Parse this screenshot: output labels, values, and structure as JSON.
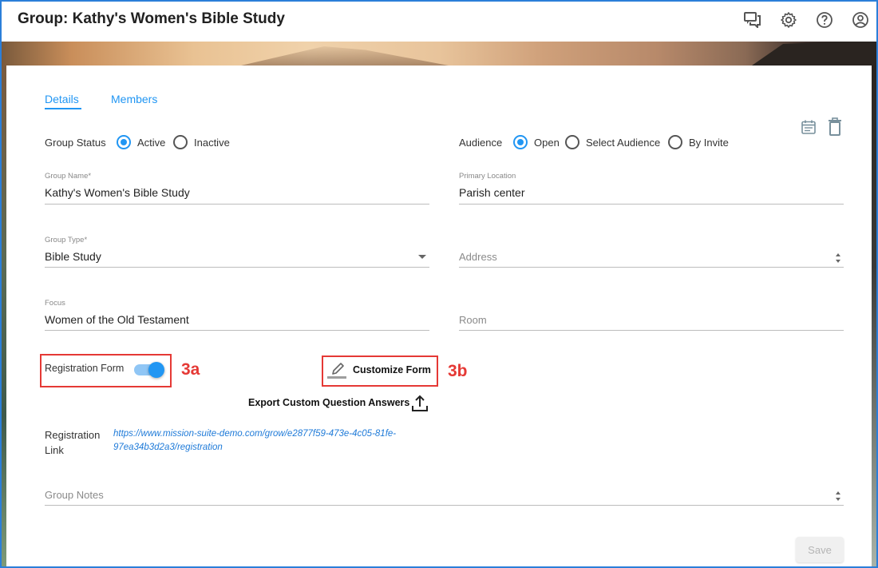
{
  "header": {
    "title": "Group: Kathy's Women's Bible Study",
    "icons": [
      "chat-icon",
      "gear-icon",
      "help-icon",
      "account-icon"
    ]
  },
  "tabs": [
    {
      "label": "Details",
      "active": true
    },
    {
      "label": "Members",
      "active": false
    }
  ],
  "group_status": {
    "label": "Group Status",
    "options": [
      "Active",
      "Inactive"
    ],
    "selected": "Active"
  },
  "audience": {
    "label": "Audience",
    "options": [
      "Open",
      "Select Audience",
      "By Invite"
    ],
    "selected": "Open"
  },
  "fields": {
    "group_name": {
      "label": "Group Name*",
      "value": "Kathy's Women's Bible Study"
    },
    "primary_location": {
      "label": "Primary Location",
      "value": "Parish center"
    },
    "group_type": {
      "label": "Group Type*",
      "value": "Bible Study"
    },
    "address": {
      "placeholder": "Address"
    },
    "focus": {
      "label": "Focus",
      "value": "Women of the Old Testament"
    },
    "room": {
      "placeholder": "Room"
    },
    "group_notes": {
      "placeholder": "Group Notes"
    }
  },
  "registration": {
    "toggle_label": "Registration Form",
    "enabled": true,
    "customize_label": "Customize Form",
    "export_label": "Export Custom Question Answers",
    "link_label_line1": "Registration",
    "link_label_line2": "Link",
    "link_line1": "https://www.mission-suite-demo.com/grow/e2877f59-473e-4c05-81fe-",
    "link_line2": "97ea34b3d2a3/registration"
  },
  "annotations": {
    "toggle": "3a",
    "customize": "3b"
  },
  "actions": {
    "save_label": "Save"
  },
  "colors": {
    "accent": "#2196f3",
    "annotation": "#e53935",
    "frame": "#2b7fd9"
  }
}
